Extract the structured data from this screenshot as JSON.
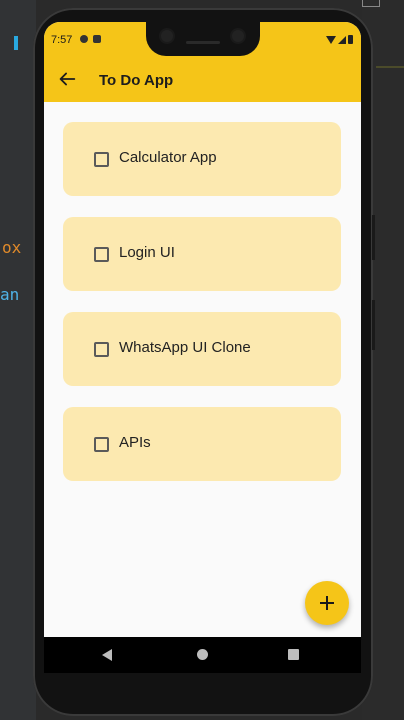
{
  "status_bar": {
    "time": "7:57"
  },
  "app_bar": {
    "title": "To Do App",
    "back_icon": "arrow-left-icon"
  },
  "tasks": [
    {
      "label": "Calculator App",
      "checked": false
    },
    {
      "label": "Login UI",
      "checked": false
    },
    {
      "label": "WhatsApp UI Clone",
      "checked": false
    },
    {
      "label": "APIs",
      "checked": false
    }
  ],
  "fab": {
    "icon": "plus-icon"
  },
  "nav_bar": {
    "back": "nav-back-icon",
    "home": "nav-home-icon",
    "recents": "nav-recents-icon"
  },
  "background_editor": {
    "fragment_1": "ox",
    "fragment_2": "an"
  },
  "colors": {
    "accent": "#f5c518",
    "card": "#fce9b0",
    "screen_bg": "#fafafa"
  }
}
